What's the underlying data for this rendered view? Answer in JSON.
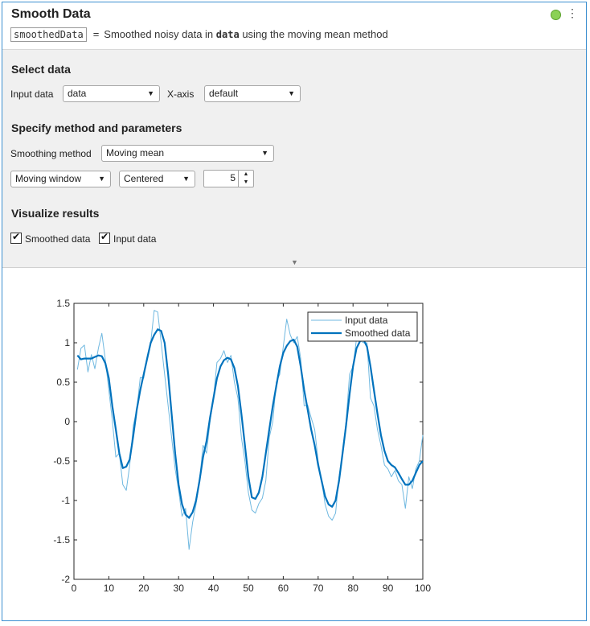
{
  "header": {
    "title": "Smooth Data",
    "output_var": "smoothedData",
    "equals": "=",
    "desc_prefix": "Smoothed noisy data in",
    "desc_var": "data",
    "desc_suffix": "using the moving mean method",
    "status_color": "#8bd156",
    "menu_icon": "⋮"
  },
  "select_data": {
    "heading": "Select data",
    "input_label": "Input data",
    "input_value": "data",
    "xaxis_label": "X-axis",
    "xaxis_value": "default"
  },
  "method": {
    "heading": "Specify method and parameters",
    "method_label": "Smoothing method",
    "method_value": "Moving mean",
    "window_type": "Moving window",
    "window_position": "Centered",
    "window_size": "5"
  },
  "visualize": {
    "heading": "Visualize results",
    "smoothed_label": "Smoothed data",
    "smoothed_checked": true,
    "input_label": "Input data",
    "input_checked": true
  },
  "chart_data": {
    "type": "line",
    "xlim": [
      0,
      100
    ],
    "ylim": [
      -2,
      1.5
    ],
    "xticks": [
      "0",
      "10",
      "20",
      "30",
      "40",
      "50",
      "60",
      "70",
      "80",
      "90",
      "100"
    ],
    "yticks": [
      "-2",
      "-1.5",
      "-1",
      "-0.5",
      "0",
      "0.5",
      "1",
      "1.5"
    ],
    "legend_position": "top-right",
    "series": [
      {
        "name": "Input data",
        "color": "#6fb8e0",
        "x": [
          1,
          2,
          3,
          4,
          5,
          6,
          7,
          8,
          9,
          10,
          11,
          12,
          13,
          14,
          15,
          16,
          17,
          18,
          19,
          20,
          21,
          22,
          23,
          24,
          25,
          26,
          27,
          28,
          29,
          30,
          31,
          32,
          33,
          34,
          35,
          36,
          37,
          38,
          39,
          40,
          41,
          42,
          43,
          44,
          45,
          46,
          47,
          48,
          49,
          50,
          51,
          52,
          53,
          54,
          55,
          56,
          57,
          58,
          59,
          60,
          61,
          62,
          63,
          64,
          65,
          66,
          67,
          68,
          69,
          70,
          71,
          72,
          73,
          74,
          75,
          76,
          77,
          78,
          79,
          80,
          81,
          82,
          83,
          84,
          85,
          86,
          87,
          88,
          89,
          90,
          91,
          92,
          93,
          94,
          95,
          96,
          97,
          98,
          99,
          100
        ],
        "y": [
          0.66,
          0.93,
          0.97,
          0.63,
          0.85,
          0.67,
          0.93,
          1.12,
          0.78,
          0.4,
          0.02,
          -0.45,
          -0.4,
          -0.8,
          -0.87,
          -0.55,
          -0.05,
          0.15,
          0.56,
          0.55,
          0.83,
          1.0,
          1.41,
          1.39,
          1.0,
          0.6,
          0.2,
          -0.2,
          -0.6,
          -0.87,
          -1.2,
          -1.1,
          -1.62,
          -1.28,
          -1.05,
          -0.75,
          -0.3,
          -0.4,
          0.0,
          0.3,
          0.75,
          0.8,
          0.9,
          0.75,
          0.84,
          0.5,
          0.3,
          -0.2,
          -0.5,
          -0.9,
          -1.12,
          -1.16,
          -1.04,
          -0.97,
          -0.75,
          -0.2,
          0.0,
          0.5,
          0.6,
          0.95,
          1.3,
          1.1,
          1.0,
          1.08,
          0.8,
          0.2,
          0.21,
          0.05,
          -0.1,
          -0.5,
          -0.75,
          -1.05,
          -1.2,
          -1.25,
          -1.16,
          -0.7,
          -0.4,
          0.0,
          0.6,
          0.7,
          1.05,
          1.03,
          1.0,
          1.0,
          0.3,
          0.2,
          -0.1,
          -0.3,
          -0.55,
          -0.6,
          -0.7,
          -0.62,
          -0.75,
          -0.8,
          -1.1,
          -0.7,
          -0.85,
          -0.6,
          -0.5,
          -0.17
        ]
      },
      {
        "name": "Smoothed data",
        "color": "#0072bd",
        "x": [
          1,
          2,
          3,
          4,
          5,
          6,
          7,
          8,
          9,
          10,
          11,
          12,
          13,
          14,
          15,
          16,
          17,
          18,
          19,
          20,
          21,
          22,
          23,
          24,
          25,
          26,
          27,
          28,
          29,
          30,
          31,
          32,
          33,
          34,
          35,
          36,
          37,
          38,
          39,
          40,
          41,
          42,
          43,
          44,
          45,
          46,
          47,
          48,
          49,
          50,
          51,
          52,
          53,
          54,
          55,
          56,
          57,
          58,
          59,
          60,
          61,
          62,
          63,
          64,
          65,
          66,
          67,
          68,
          69,
          70,
          71,
          72,
          73,
          74,
          75,
          76,
          77,
          78,
          79,
          80,
          81,
          82,
          83,
          84,
          85,
          86,
          87,
          88,
          89,
          90,
          91,
          92,
          93,
          94,
          95,
          96,
          97,
          98,
          99,
          100
        ],
        "y": [
          0.84,
          0.79,
          0.8,
          0.8,
          0.8,
          0.82,
          0.84,
          0.83,
          0.74,
          0.55,
          0.2,
          -0.1,
          -0.4,
          -0.59,
          -0.57,
          -0.48,
          -0.18,
          0.15,
          0.4,
          0.6,
          0.8,
          1.0,
          1.1,
          1.17,
          1.15,
          1.0,
          0.6,
          0.1,
          -0.4,
          -0.8,
          -1.05,
          -1.18,
          -1.22,
          -1.15,
          -1.0,
          -0.75,
          -0.45,
          -0.25,
          0.05,
          0.3,
          0.55,
          0.7,
          0.78,
          0.81,
          0.79,
          0.68,
          0.45,
          0.1,
          -0.3,
          -0.7,
          -0.96,
          -0.98,
          -0.9,
          -0.7,
          -0.4,
          -0.1,
          0.2,
          0.45,
          0.7,
          0.87,
          0.96,
          1.02,
          1.04,
          0.95,
          0.7,
          0.4,
          0.15,
          -0.1,
          -0.3,
          -0.55,
          -0.75,
          -0.95,
          -1.05,
          -1.08,
          -1.0,
          -0.75,
          -0.4,
          -0.05,
          0.35,
          0.7,
          0.93,
          1.02,
          1.04,
          0.95,
          0.7,
          0.4,
          0.1,
          -0.17,
          -0.37,
          -0.5,
          -0.55,
          -0.58,
          -0.65,
          -0.73,
          -0.8,
          -0.8,
          -0.75,
          -0.65,
          -0.55,
          -0.5
        ]
      }
    ]
  }
}
